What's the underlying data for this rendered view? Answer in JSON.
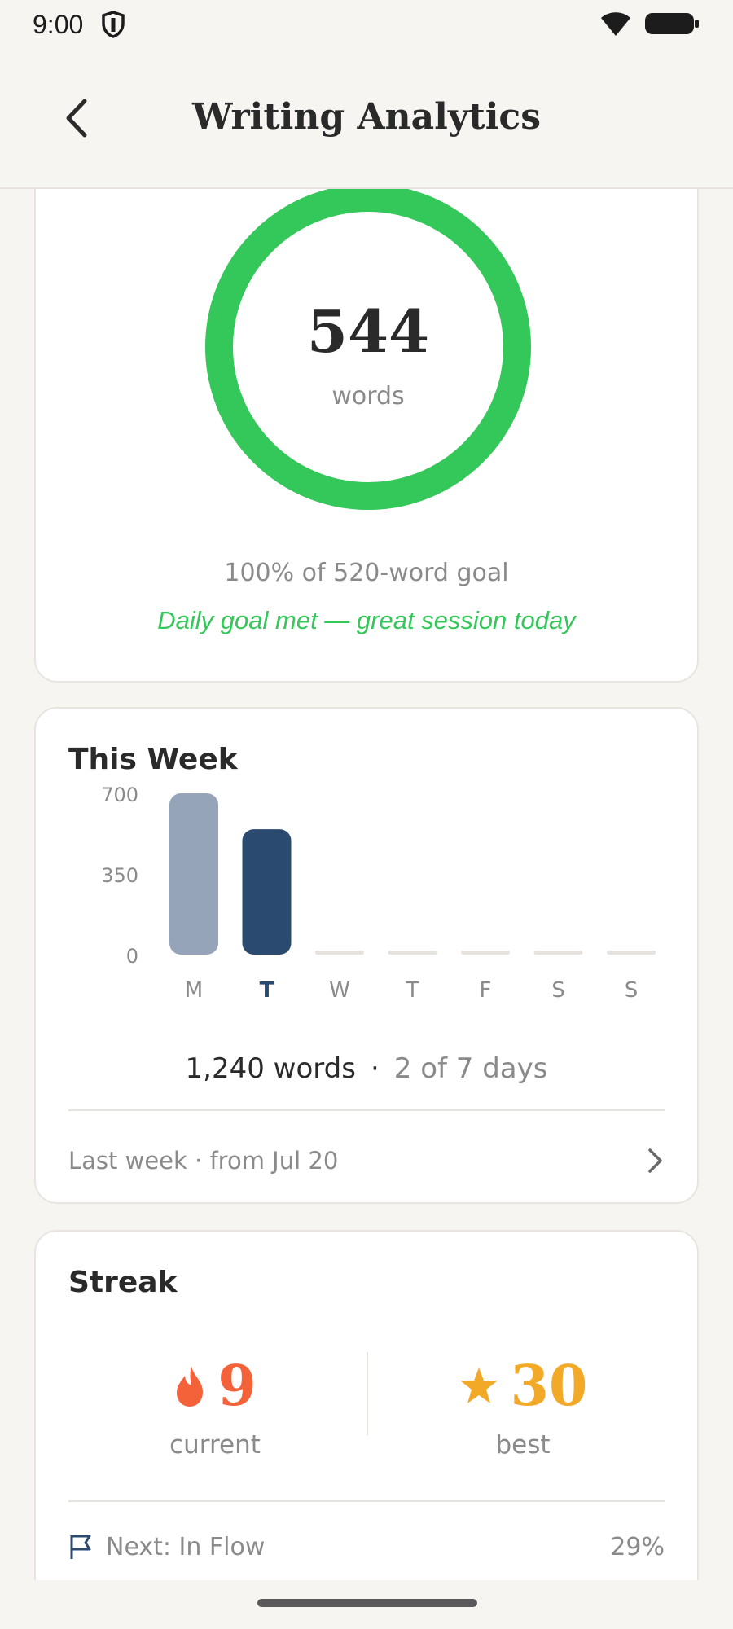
{
  "status_bar": {
    "time": "9:00",
    "shield_icon": "shield-icon",
    "wifi_icon": "wifi-icon",
    "battery_icon": "battery-icon"
  },
  "header": {
    "title": "Writing Analytics",
    "back_icon": "chevron-left-icon"
  },
  "daily_goal": {
    "words": "544",
    "unit": "words",
    "goal_text": "100% of 520-word goal",
    "message": "Daily goal met — great session today",
    "progress": 1.0,
    "ring_color": "#34c759"
  },
  "week": {
    "heading": "This Week",
    "total": "1,240 words",
    "separator": "·",
    "days": "2 of 7 days",
    "last_week_label": "Last week · from Jul 20",
    "chart_data": {
      "type": "bar",
      "categories": [
        "M",
        "T",
        "W",
        "T",
        "F",
        "S",
        "S"
      ],
      "values": [
        700,
        544,
        0,
        0,
        0,
        0,
        0
      ],
      "ylim": [
        0,
        700
      ],
      "yticks": [
        "700",
        "350",
        "0"
      ],
      "current_day_index": 1,
      "colors": {
        "past": "#95a4b8",
        "current": "#2b4a6f",
        "empty": "#e6e3de"
      }
    }
  },
  "streak": {
    "heading": "Streak",
    "current_value": "9",
    "current_label": "current",
    "current_icon": "flame-icon",
    "best_value": "30",
    "best_label": "best",
    "best_icon": "star-icon",
    "colors": {
      "current": "#f4623a",
      "best": "#f2a928"
    },
    "next_label": "Next: In Flow",
    "next_icon": "flag-icon",
    "next_percent": "29%",
    "next_progress": 0.29
  }
}
